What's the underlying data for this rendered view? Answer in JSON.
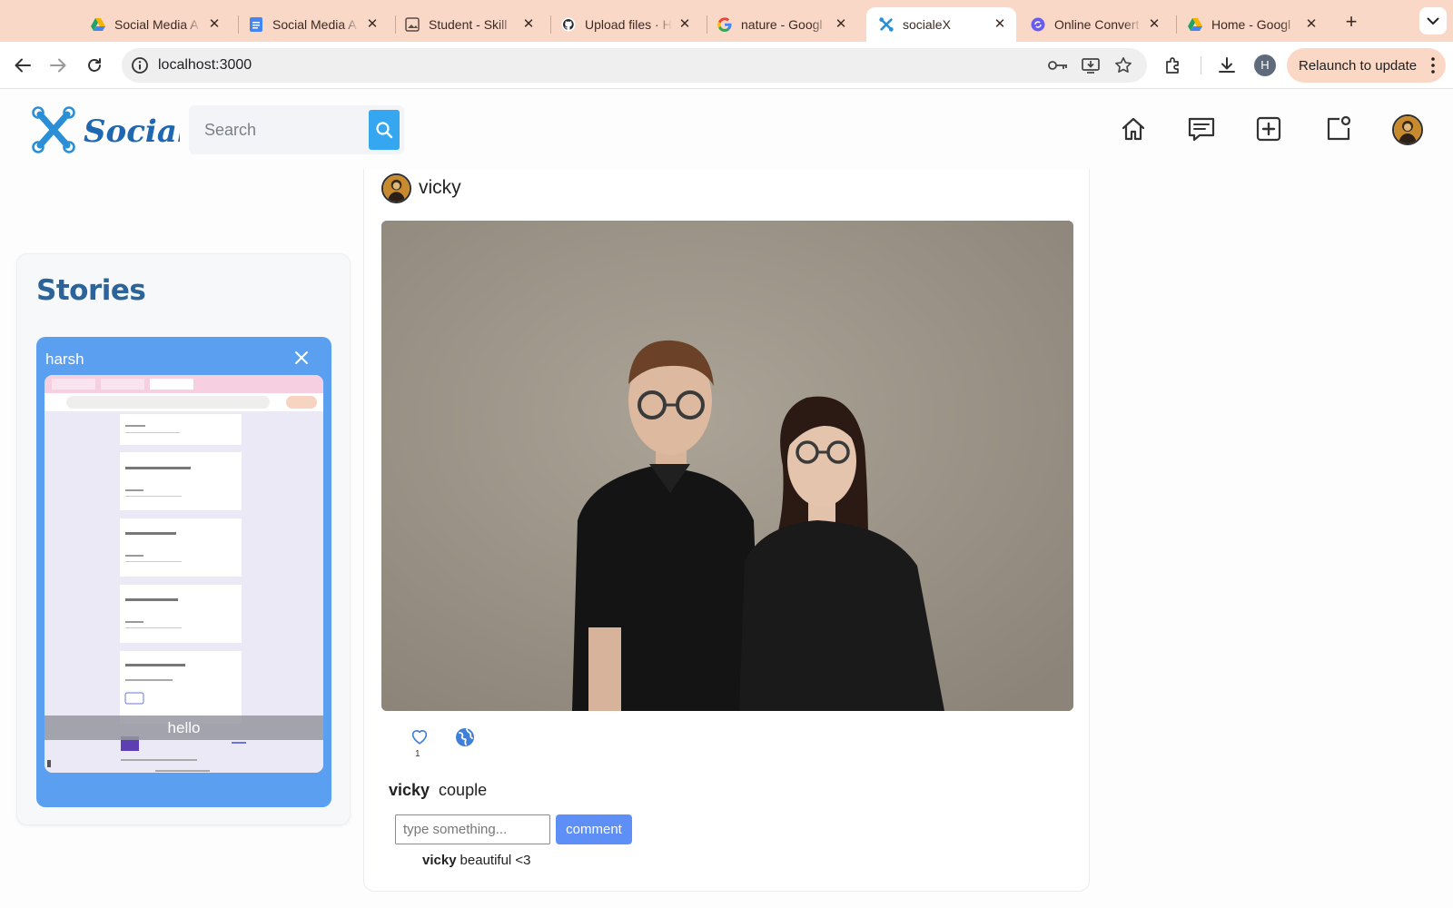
{
  "browser": {
    "tabs": [
      {
        "title": "Social Media A",
        "icon": "google-drive-icon"
      },
      {
        "title": "Social Media A",
        "icon": "google-docs-icon"
      },
      {
        "title": "Student - Skill",
        "icon": "image-icon"
      },
      {
        "title": "Upload files · H",
        "icon": "github-icon"
      },
      {
        "title": "nature - Googl",
        "icon": "google-icon"
      },
      {
        "title": "socialeX",
        "icon": "socialex-icon",
        "active": true
      },
      {
        "title": "Online Convert",
        "icon": "converter-icon"
      },
      {
        "title": "Home - Googl",
        "icon": "google-drive-icon"
      }
    ],
    "url": "localhost:3000",
    "profile_initial": "H",
    "relaunch_label": "Relaunch to update",
    "accent_color": "#f9d8c7"
  },
  "app": {
    "brand": "SocialeX",
    "search_placeholder": "Search",
    "nav": [
      "home",
      "messages",
      "create-post",
      "notifications",
      "profile"
    ]
  },
  "stories": {
    "title": "Stories",
    "items": [
      {
        "user": "harsh",
        "caption": "hello"
      }
    ]
  },
  "post": {
    "user": "vicky",
    "likes": "1",
    "caption_user": "vicky",
    "caption_text": "couple",
    "comment_placeholder": "type something...",
    "comment_button": "comment",
    "comments": [
      {
        "user": "vicky",
        "text": "beautiful <3"
      }
    ]
  }
}
